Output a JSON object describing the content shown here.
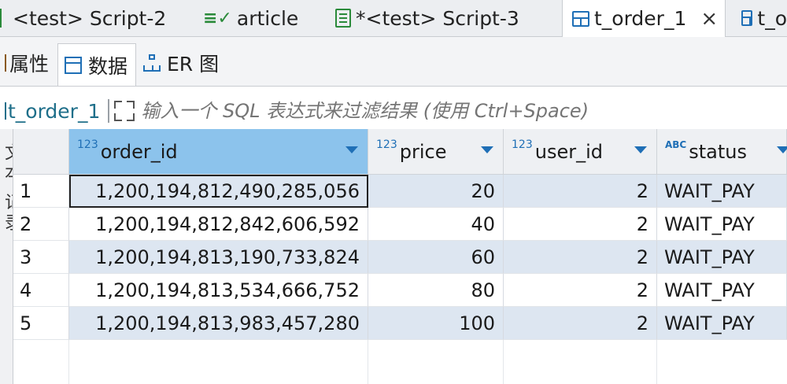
{
  "editor_tabs": [
    {
      "label": "<test> Script-2",
      "icon": "script-icon"
    },
    {
      "label": "article",
      "icon": "article-icon"
    },
    {
      "label": "*<test> Script-3",
      "icon": "script-icon"
    },
    {
      "label": "t_order_1",
      "icon": "table-icon",
      "active": true,
      "close": "×"
    },
    {
      "label": "t_o",
      "icon": "table-icon"
    }
  ],
  "sub_tabs": [
    {
      "label": "属性",
      "icon": "properties-icon"
    },
    {
      "label": "数据",
      "icon": "data-icon",
      "active": true
    },
    {
      "label": "ER 图",
      "icon": "er-diagram-icon"
    }
  ],
  "filter": {
    "label": "t_order_1",
    "placeholder": "输入一个 SQL 表达式来过滤结果 (使用 Ctrl+Space)"
  },
  "side_strip": {
    "text": "文本 记录"
  },
  "grid": {
    "columns": [
      {
        "name": "order_id",
        "type_badge": "123",
        "selected": true
      },
      {
        "name": "price",
        "type_badge": "123"
      },
      {
        "name": "user_id",
        "type_badge": "123"
      },
      {
        "name": "status",
        "type_badge": "ABC"
      }
    ],
    "rows": [
      {
        "num": "1",
        "order_id": "1,200,194,812,490,285,056",
        "price": "20",
        "user_id": "2",
        "status": "WAIT_PAY"
      },
      {
        "num": "2",
        "order_id": "1,200,194,812,842,606,592",
        "price": "40",
        "user_id": "2",
        "status": "WAIT_PAY"
      },
      {
        "num": "3",
        "order_id": "1,200,194,813,190,733,824",
        "price": "60",
        "user_id": "2",
        "status": "WAIT_PAY"
      },
      {
        "num": "4",
        "order_id": "1,200,194,813,534,666,752",
        "price": "80",
        "user_id": "2",
        "status": "WAIT_PAY"
      },
      {
        "num": "5",
        "order_id": "1,200,194,813,983,457,280",
        "price": "100",
        "user_id": "2",
        "status": "WAIT_PAY"
      }
    ]
  },
  "colors": {
    "selected_header": "#8cc3ec",
    "odd_row": "#dde6f1",
    "accent": "#1f6fb6"
  }
}
